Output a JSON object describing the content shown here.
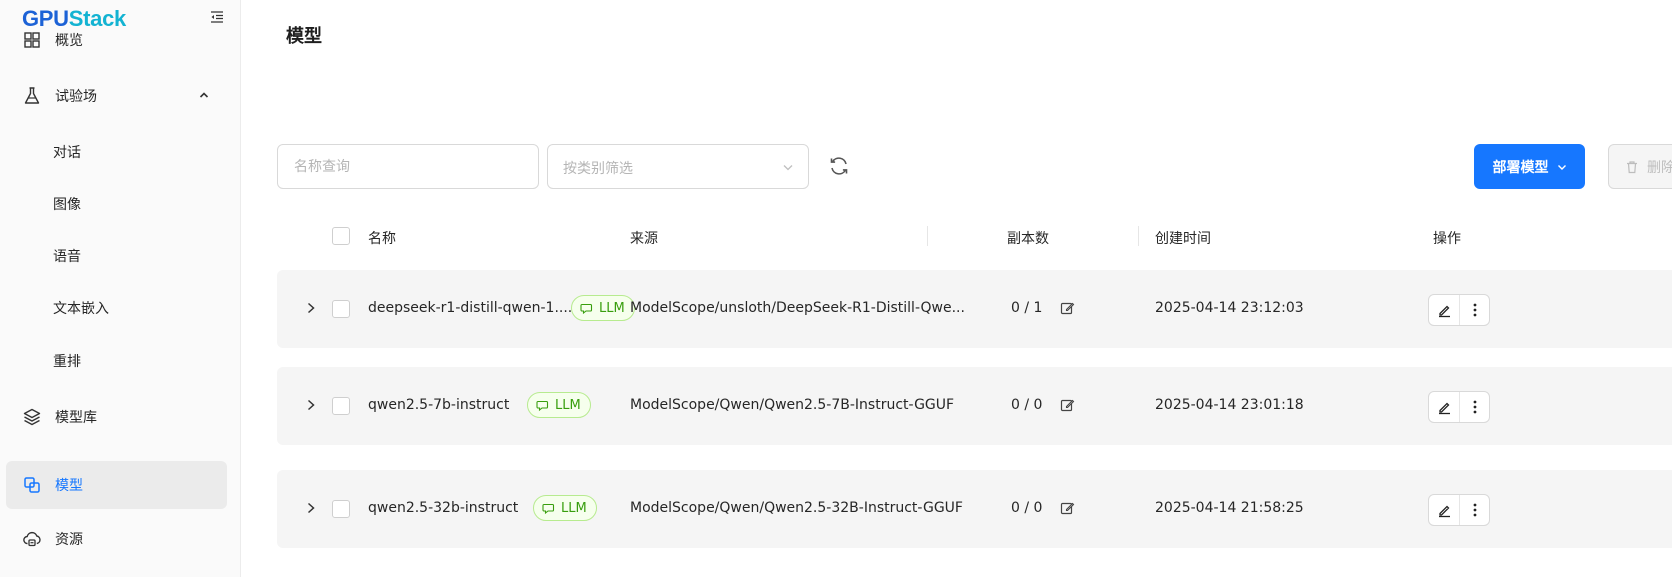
{
  "brand": {
    "part1": "GPU",
    "part2": "Stack"
  },
  "sidebar": {
    "items": [
      {
        "label": "概览"
      },
      {
        "label": "试验场"
      },
      {
        "label": "对话"
      },
      {
        "label": "图像"
      },
      {
        "label": "语音"
      },
      {
        "label": "文本嵌入"
      },
      {
        "label": "重排"
      },
      {
        "label": "模型库"
      },
      {
        "label": "模型"
      },
      {
        "label": "资源"
      }
    ],
    "active": "模型"
  },
  "page": {
    "title": "模型"
  },
  "toolbar": {
    "search_placeholder": "名称查询",
    "category_placeholder": "按类别筛选",
    "deploy_label": "部署模型",
    "delete_label": "删除"
  },
  "table": {
    "columns": [
      "名称",
      "来源",
      "副本数",
      "创建时间",
      "操作"
    ],
    "rows": [
      {
        "name": "deepseek-r1-distill-qwen-1....",
        "tag": "LLM",
        "source": "ModelScope/unsloth/DeepSeek-R1-Distill-Qwe...",
        "replicas": "0 / 1",
        "created": "2025-04-14 23:12:03"
      },
      {
        "name": "qwen2.5-7b-instruct",
        "tag": "LLM",
        "source": "ModelScope/Qwen/Qwen2.5-7B-Instruct-GGUF",
        "replicas": "0 / 0",
        "created": "2025-04-14 23:01:18"
      },
      {
        "name": "qwen2.5-32b-instruct",
        "tag": "LLM",
        "source": "ModelScope/Qwen/Qwen2.5-32B-Instruct-GGUF",
        "replicas": "0 / 0",
        "created": "2025-04-14 21:58:25"
      }
    ]
  },
  "colors": {
    "accent": "#1677ff",
    "brand_dark": "#1c62d6",
    "brand_light": "#13b3d2",
    "tag_green": "#389e0d"
  },
  "icons": [
    "collapse-icon",
    "dashboard-icon",
    "flask-icon",
    "chevron-up-icon",
    "layers-icon",
    "model-icon",
    "cloud-resource-icon",
    "chevron-down-icon",
    "refresh-icon",
    "trash-icon",
    "chevron-right-icon",
    "chat-bubble-icon",
    "edit-icon",
    "more-vertical-icon"
  ]
}
